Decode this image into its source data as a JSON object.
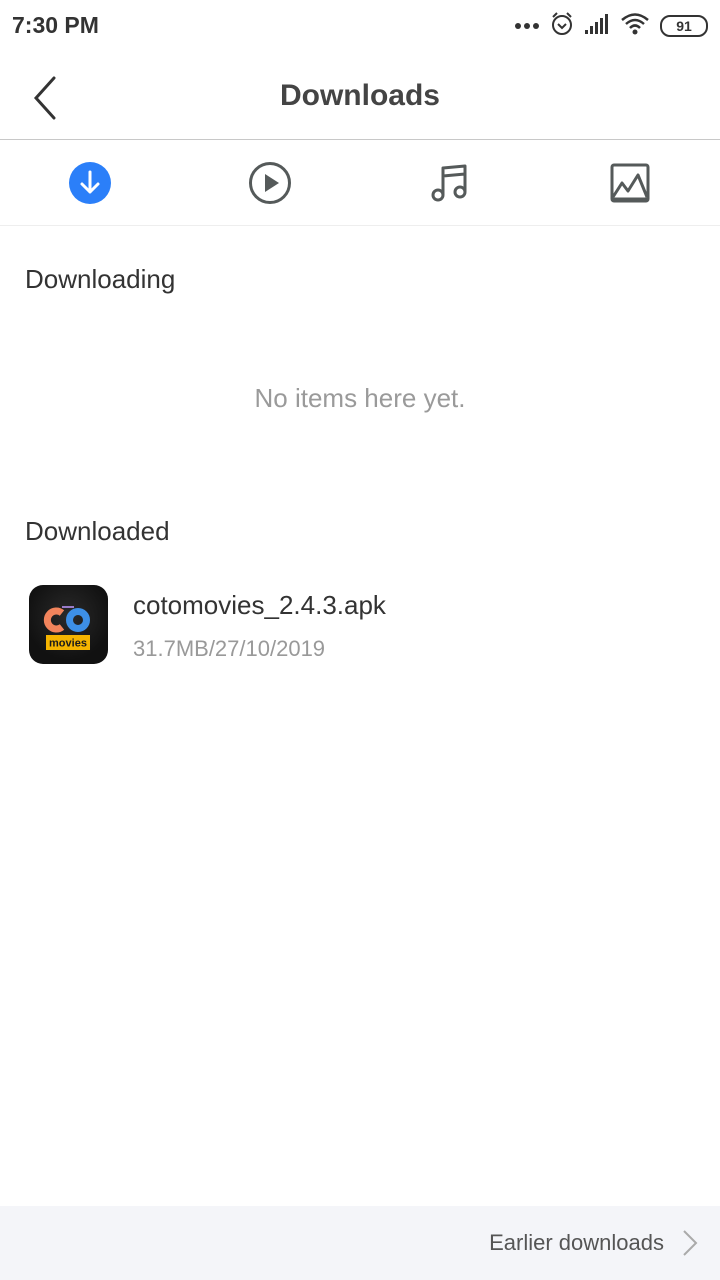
{
  "status_bar": {
    "time": "7:30 PM",
    "battery": "91",
    "icons": [
      "more-dots-icon",
      "alarm-icon",
      "signal-icon",
      "wifi-icon",
      "battery-icon"
    ]
  },
  "header": {
    "title": "Downloads",
    "back_icon": "chevron-left-icon"
  },
  "tabs": [
    {
      "name": "downloads",
      "icon": "download-circle-icon",
      "active": true
    },
    {
      "name": "videos",
      "icon": "play-circle-icon",
      "active": false
    },
    {
      "name": "music",
      "icon": "music-note-icon",
      "active": false
    },
    {
      "name": "images",
      "icon": "image-icon",
      "active": false
    }
  ],
  "colors": {
    "accent": "#2b7ff9",
    "icon_gray": "#555a5a"
  },
  "downloading": {
    "title": "Downloading",
    "empty_text": "No items here yet."
  },
  "downloaded": {
    "title": "Downloaded",
    "items": [
      {
        "name": "cotomovies_2.4.3.apk",
        "meta": "31.7MB/27/10/2019",
        "icon_text_top": "CO",
        "icon_text_badge": "movies"
      }
    ]
  },
  "footer": {
    "earlier_label": "Earlier downloads"
  }
}
